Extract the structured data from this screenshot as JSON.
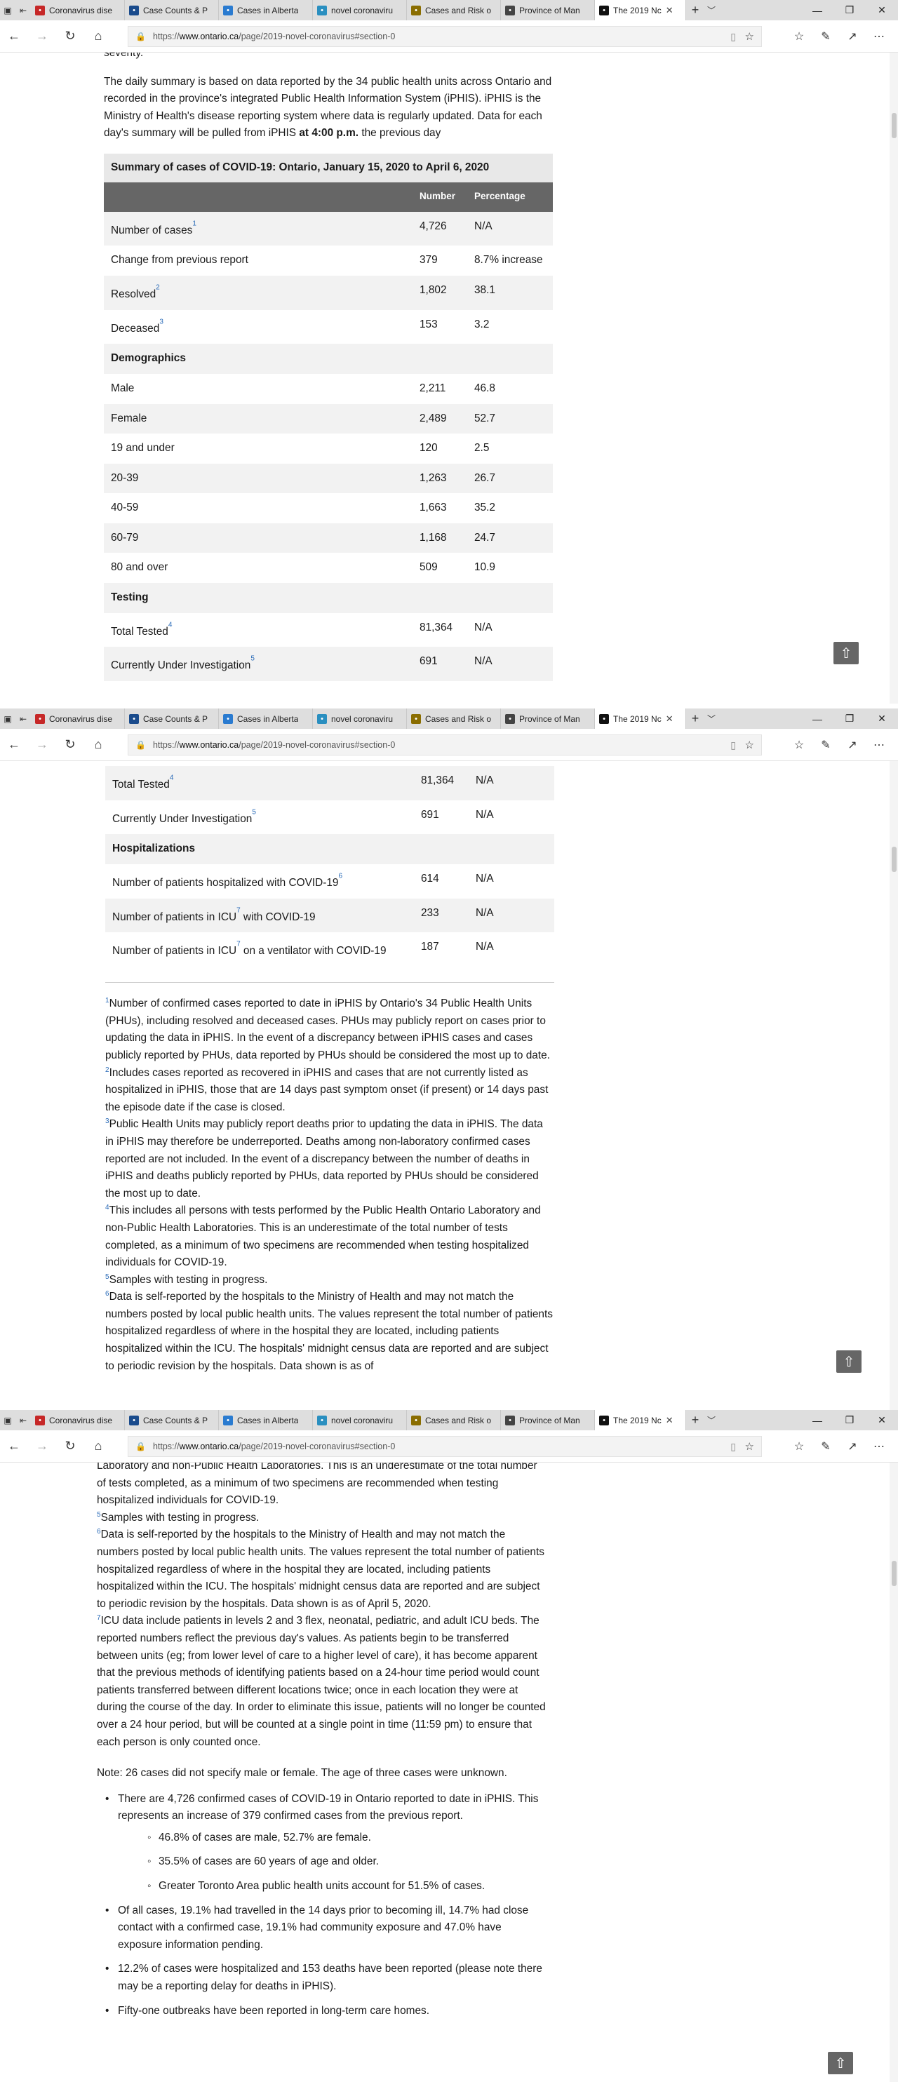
{
  "browser": {
    "tabs": [
      {
        "label": "Coronavirus dise",
        "icon": "maple-leaf-icon",
        "color": "#c62828"
      },
      {
        "label": "Case Counts & P",
        "icon": "site-icon",
        "color": "#1a4b8c"
      },
      {
        "label": "Cases in Alberta",
        "icon": "chart-icon",
        "color": "#2a7bd0"
      },
      {
        "label": "novel coronaviru",
        "icon": "virus-icon",
        "color": "#2a8fc0"
      },
      {
        "label": "Cases and Risk o",
        "icon": "document-icon",
        "color": "#8a6d00"
      },
      {
        "label": "Province of Man",
        "icon": "manitoba-icon",
        "color": "#444"
      },
      {
        "label": "The 2019 Nc",
        "icon": "ontario-icon",
        "color": "#111",
        "active": true
      }
    ],
    "url_prefix": "https://",
    "url_domain": "www.ontario.ca",
    "url_path": "/page/2019-novel-coronavirus#section-0"
  },
  "intro": {
    "top_fragment": "severity.",
    "text": "The daily summary is based on data reported by the 34 public health units across Ontario and recorded in the province's integrated Public Health Information System (iPHIS). iPHIS is the Ministry of Health's disease reporting system where data is regularly updated. Data for each day's summary will be pulled from iPHIS",
    "bold": "at 4:00 p.m.",
    "after": "the previous day"
  },
  "table": {
    "caption": "Summary of cases of COVID-19: Ontario, January 15, 2020 to April 6, 2020",
    "headers": [
      "",
      "Number",
      "Percentage"
    ],
    "rows": [
      {
        "label": "Number of cases",
        "sup": "1",
        "number": "4,726",
        "pct": "N/A"
      },
      {
        "label": "Change from previous report",
        "number": "379",
        "pct": "8.7% increase"
      },
      {
        "label": "Resolved",
        "sup": "2",
        "number": "1,802",
        "pct": "38.1"
      },
      {
        "label": "Deceased",
        "sup": "3",
        "number": "153",
        "pct": "3.2"
      },
      {
        "label": "Demographics",
        "subheading": true
      },
      {
        "label": "Male",
        "number": "2,211",
        "pct": "46.8"
      },
      {
        "label": "Female",
        "number": "2,489",
        "pct": "52.7"
      },
      {
        "label": "19 and under",
        "number": "120",
        "pct": "2.5"
      },
      {
        "label": "20-39",
        "number": "1,263",
        "pct": "26.7"
      },
      {
        "label": "40-59",
        "number": "1,663",
        "pct": "35.2"
      },
      {
        "label": "60-79",
        "number": "1,168",
        "pct": "24.7"
      },
      {
        "label": "80 and over",
        "number": "509",
        "pct": "10.9"
      },
      {
        "label": "Testing",
        "subheading": true
      },
      {
        "label": "Total Tested",
        "sup": "4",
        "number": "81,364",
        "pct": "N/A"
      },
      {
        "label": "Currently Under Investigation",
        "sup": "5",
        "number": "691",
        "pct": "N/A"
      },
      {
        "label": "Hospitalizations",
        "subheading": true
      },
      {
        "label": "Number of patients hospitalized with COVID-19",
        "sup": "6",
        "number": "614",
        "pct": "N/A"
      },
      {
        "label": "Number of patients in ICU",
        "sup": "7",
        "label_after": " with COVID-19",
        "number": "233",
        "pct": "N/A"
      },
      {
        "label": "Number of patients in ICU",
        "sup": "7",
        "label_after": " on a ventilator with COVID-19",
        "number": "187",
        "pct": "N/A"
      }
    ]
  },
  "footnotes": [
    {
      "n": "1",
      "text": "Number of confirmed cases reported to date in iPHIS by Ontario's 34 Public Health Units (PHUs), including resolved and deceased cases.  PHUs may publicly report on cases prior to updating the data in iPHIS.  In the event of a discrepancy between iPHIS cases and cases publicly reported by PHUs, data reported by PHUs should be considered the most up to date."
    },
    {
      "n": "2",
      "text": "Includes cases reported as recovered in iPHIS and cases that are not currently listed as hospitalized in iPHIS, those that are 14 days past symptom onset (if present) or 14 days past the episode date if the case is closed."
    },
    {
      "n": "3",
      "text": "Public Health Units may publicly report deaths prior to updating the data in iPHIS. The data in iPHIS may therefore be underreported. Deaths among non-laboratory confirmed cases reported are not included. In the event of a discrepancy between the number of deaths in iPHIS and deaths publicly reported by PHUs, data reported by PHUs should be considered the most up to date."
    },
    {
      "n": "4",
      "text": "This includes all persons with tests performed by the Public Health Ontario Laboratory  and non-Public Health Laboratories.  This is an underestimate of the total number of tests completed, as a minimum of two specimens are recommended when testing hospitalized individuals for COVID-19."
    },
    {
      "n": "5",
      "text": "Samples with testing in progress."
    },
    {
      "n": "6",
      "text": "Data is self-reported by the hospitals to the Ministry of Health and may not match the numbers posted by local public health units. The values represent the total number of patients hospitalized regardless of where in the hospital they are located, including patients hospitalized within the ICU. The hospitals' midnight census data are reported and are subject to periodic revision by the hospitals. Data shown is as of April 5, 2020."
    },
    {
      "n": "7",
      "text": "ICU data include patients in levels 2 and 3  flex, neonatal, pediatric, and adult ICU beds. The reported numbers reflect the previous day's values. As patients begin to be transferred between units (eg; from lower level of care to a higher level of care), it has become apparent that the previous methods of identifying patients based on a 24-hour time period would count patients transferred between different locations twice; once in each location they were at during the course of the day. In order to eliminate this issue, patients will no longer be counted over a 24 hour period, but will be counted at a single point in time (11:59 pm) to ensure that each person is only counted once."
    }
  ],
  "shot3_top_fragment": "Laboratory  and non-Public Health Laboratories.  This is an underestimate of the total number of tests completed, as a minimum of two specimens are recommended when testing hospitalized individuals for COVID-19.",
  "shot2_fn6_partial": "Data is self-reported by the hospitals to the Ministry of Health and may not match the numbers posted by local public health units. The values represent the total number of patients hospitalized regardless of where in the hospital they are located, including patients hospitalized within the ICU. The hospitals' midnight census data are reported and are subject to periodic revision by the hospitals. Data shown is as of",
  "note": "Note: 26 cases did not specify male or female. The age of three cases were unknown.",
  "bullets": [
    {
      "text": "There are 4,726 confirmed cases of COVID-19 in Ontario reported to date in iPHIS. This represents an increase of 379 confirmed cases from the previous report.",
      "sub": [
        "46.8% of cases are male, 52.7% are female.",
        "35.5% of cases are 60 years of age and older.",
        "Greater Toronto Area public health units account for 51.5% of cases."
      ]
    },
    {
      "text": "Of all cases, 19.1% had travelled in the 14 days prior to becoming ill, 14.7% had close contact with a confirmed case, 19.1% had community exposure and 47.0% have exposure information pending."
    },
    {
      "text": "12.2% of cases were hospitalized and 153 deaths have been reported (please note there may be a reporting delay for deaths in iPHIS)."
    },
    {
      "text": "Fifty-one outbreaks have been reported in long-term care homes."
    }
  ]
}
